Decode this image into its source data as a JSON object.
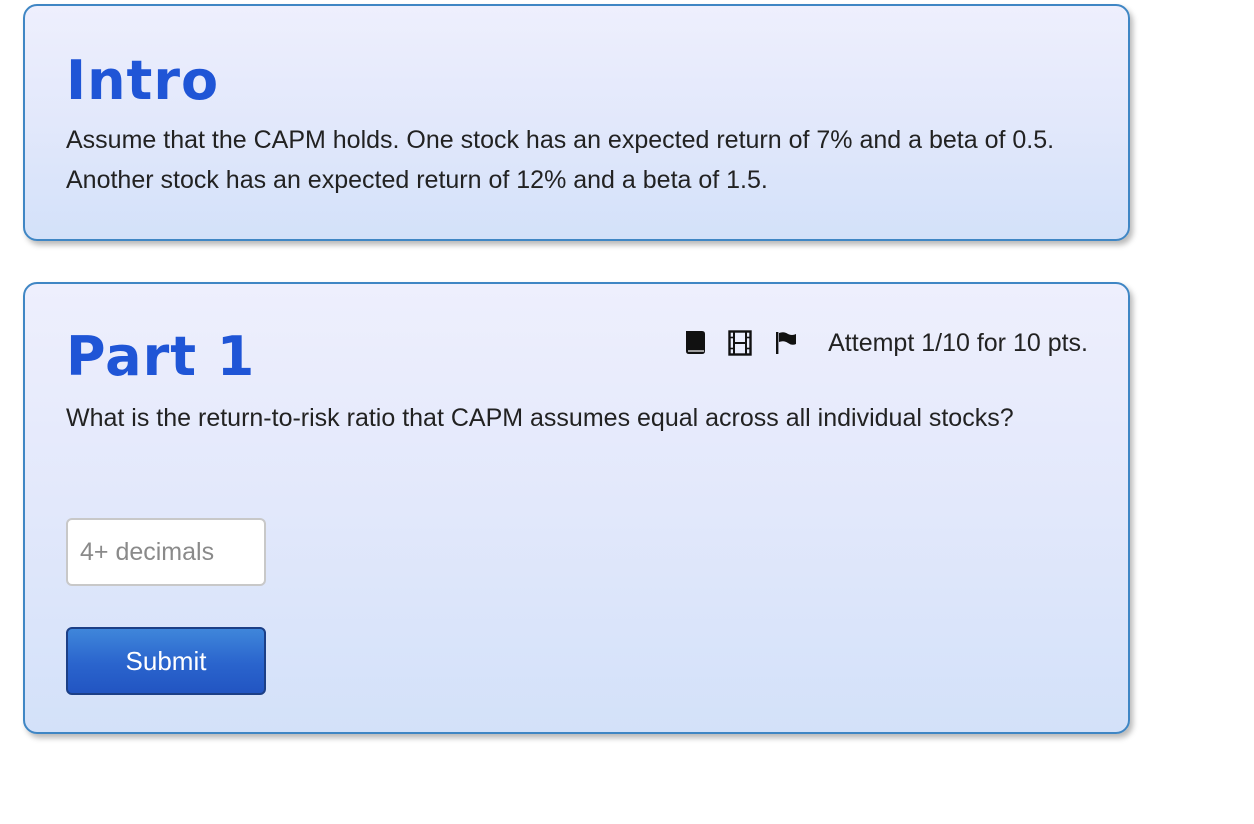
{
  "intro": {
    "title": "Intro",
    "text": "Assume that the CAPM holds. One stock has an expected return of 7% and a beta of 0.5. Another stock has an expected return of 12% and a beta of 1.5."
  },
  "part1": {
    "title": "Part 1",
    "question": "What is the return-to-risk ratio that CAPM assumes equal across all individual stocks?",
    "attempt": "Attempt 1/10 for 10 pts.",
    "icons": [
      "book-icon",
      "film-icon",
      "flag-icon"
    ],
    "input": {
      "value": "",
      "placeholder": "4+ decimals"
    },
    "submit_label": "Submit"
  },
  "colors": {
    "title": "#1f55d6",
    "card_border": "#3f86c4",
    "button": "#2a64cd"
  }
}
